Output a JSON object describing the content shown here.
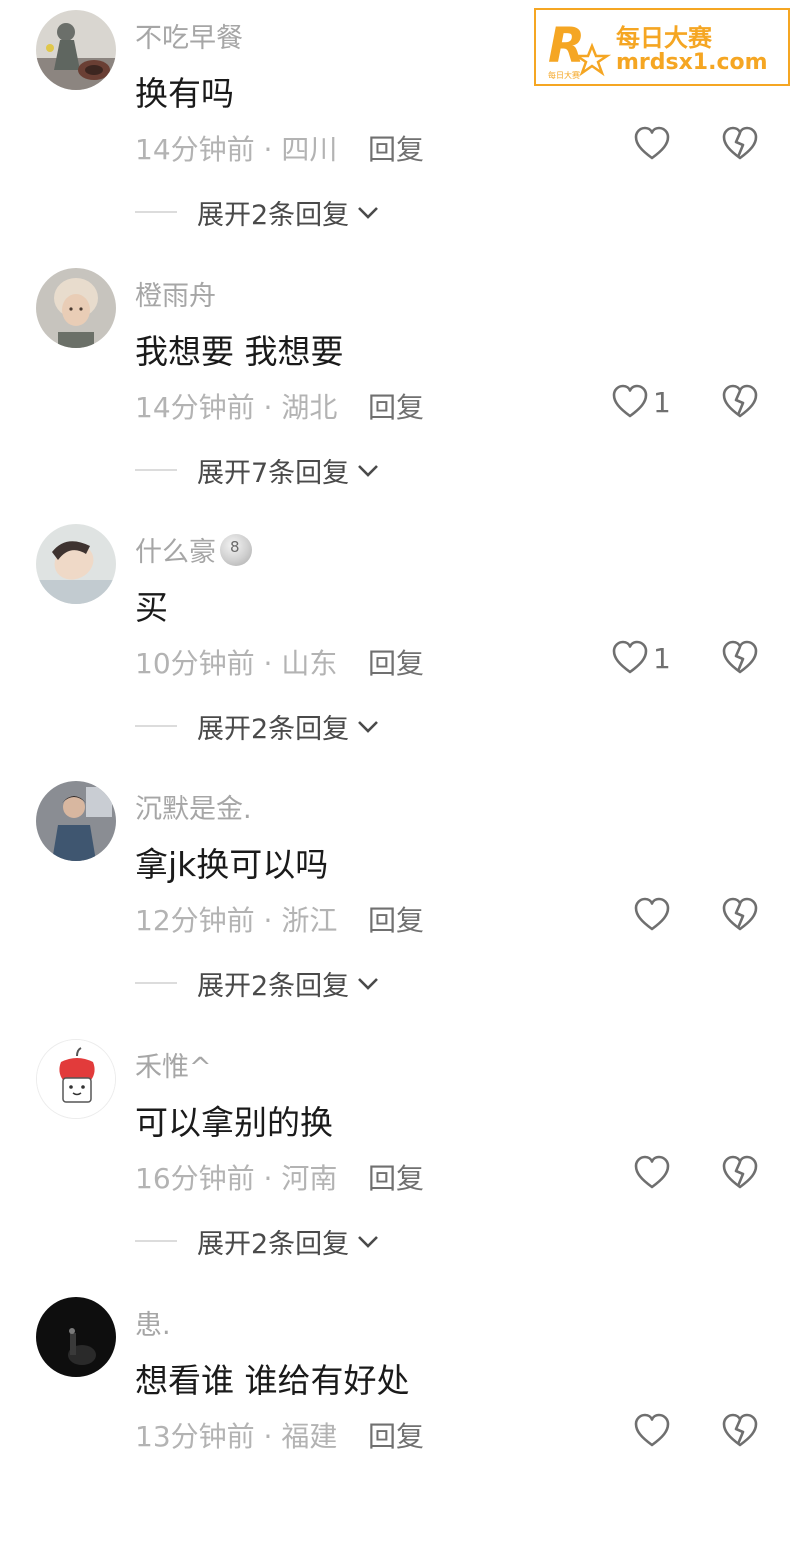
{
  "watermark": {
    "title": "每日大赛",
    "url": "mrdsx1.com",
    "logo_letter": "R",
    "logo_small": "每日大赛",
    "color": "#f5a623"
  },
  "reply_label": "回复",
  "comments": [
    {
      "username": "不吃早餐",
      "text": "换有吗",
      "meta": "14分钟前 · 四川",
      "likes": "",
      "expand": "展开2条回复",
      "avatar": "photo-figure-icon"
    },
    {
      "username": "橙雨舟",
      "text": "我想要 我想要",
      "meta": "14分钟前 · 湖北",
      "likes": "1",
      "expand": "展开7条回复",
      "avatar": "photo-person-icon"
    },
    {
      "username": "什么豪",
      "text": "买",
      "meta": "10分钟前 · 山东",
      "likes": "1",
      "expand": "展开2条回复",
      "avatar": "photo-person-icon",
      "badge": "8-ball-icon"
    },
    {
      "username": "沉默是金.",
      "text": "拿jk换可以吗",
      "meta": "12分钟前 · 浙江",
      "likes": "",
      "expand": "展开2条回复",
      "avatar": "photo-person-icon"
    },
    {
      "username": "禾惟^",
      "text": "可以拿别的换",
      "meta": "16分钟前 · 河南",
      "likes": "",
      "expand": "展开2条回复",
      "avatar": "cartoon-apple-icon"
    },
    {
      "username": "患.",
      "text": "想看谁 谁给有好处",
      "meta": "13分钟前 · 福建",
      "likes": "",
      "expand": "",
      "avatar": "photo-dark-icon"
    }
  ]
}
